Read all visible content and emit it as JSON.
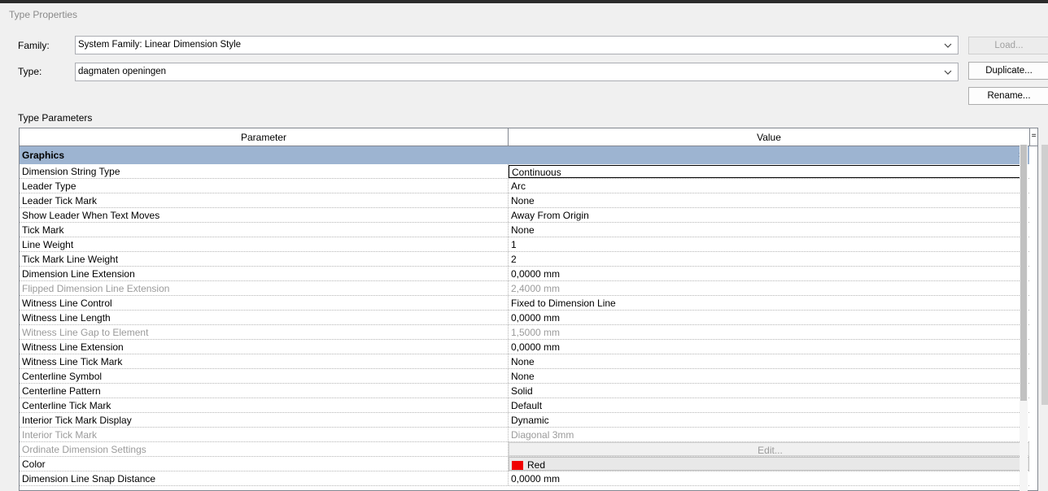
{
  "window": {
    "title": "Type Properties"
  },
  "family": {
    "label": "Family:",
    "value": "System Family: Linear Dimension Style"
  },
  "type": {
    "label": "Type:",
    "value": "dagmaten openingen"
  },
  "buttons": {
    "load": "Load...",
    "duplicate": "Duplicate...",
    "rename": "Rename..."
  },
  "section_label": "Type Parameters",
  "grid": {
    "col_parameter": "Parameter",
    "col_value": "Value",
    "eq_button": "=",
    "group": "Graphics",
    "rows": [
      {
        "p": "Dimension String Type",
        "v": "Continuous"
      },
      {
        "p": "Leader Type",
        "v": "Arc"
      },
      {
        "p": "Leader Tick Mark",
        "v": "None"
      },
      {
        "p": "Show Leader When Text Moves",
        "v": "Away From Origin"
      },
      {
        "p": "Tick Mark",
        "v": "None"
      },
      {
        "p": "Line Weight",
        "v": "1"
      },
      {
        "p": "Tick Mark Line Weight",
        "v": "2"
      },
      {
        "p": "Dimension Line Extension",
        "v": "0,0000 mm"
      },
      {
        "p": "Flipped Dimension Line Extension",
        "v": "2,4000 mm"
      },
      {
        "p": "Witness Line Control",
        "v": "Fixed to Dimension Line"
      },
      {
        "p": "Witness Line Length",
        "v": "0,0000 mm"
      },
      {
        "p": "Witness Line Gap to Element",
        "v": "1,5000 mm"
      },
      {
        "p": "Witness Line Extension",
        "v": "0,0000 mm"
      },
      {
        "p": "Witness Line Tick Mark",
        "v": "None"
      },
      {
        "p": "Centerline Symbol",
        "v": "None"
      },
      {
        "p": "Centerline Pattern",
        "v": "Solid"
      },
      {
        "p": "Centerline Tick Mark",
        "v": "Default"
      },
      {
        "p": "Interior Tick Mark Display",
        "v": "Dynamic"
      },
      {
        "p": "Interior Tick Mark",
        "v": "Diagonal 3mm"
      },
      {
        "p": "Ordinate Dimension Settings",
        "v": "Edit..."
      },
      {
        "p": "Color",
        "v": "Red"
      },
      {
        "p": "Dimension Line Snap Distance",
        "v": "0,0000 mm"
      }
    ]
  },
  "colors": {
    "group_bg": "#9db4d1",
    "swatch": "#f00000"
  },
  "icons": {
    "combo": "chevron-down-icon",
    "group": "collapse-up-icon"
  }
}
